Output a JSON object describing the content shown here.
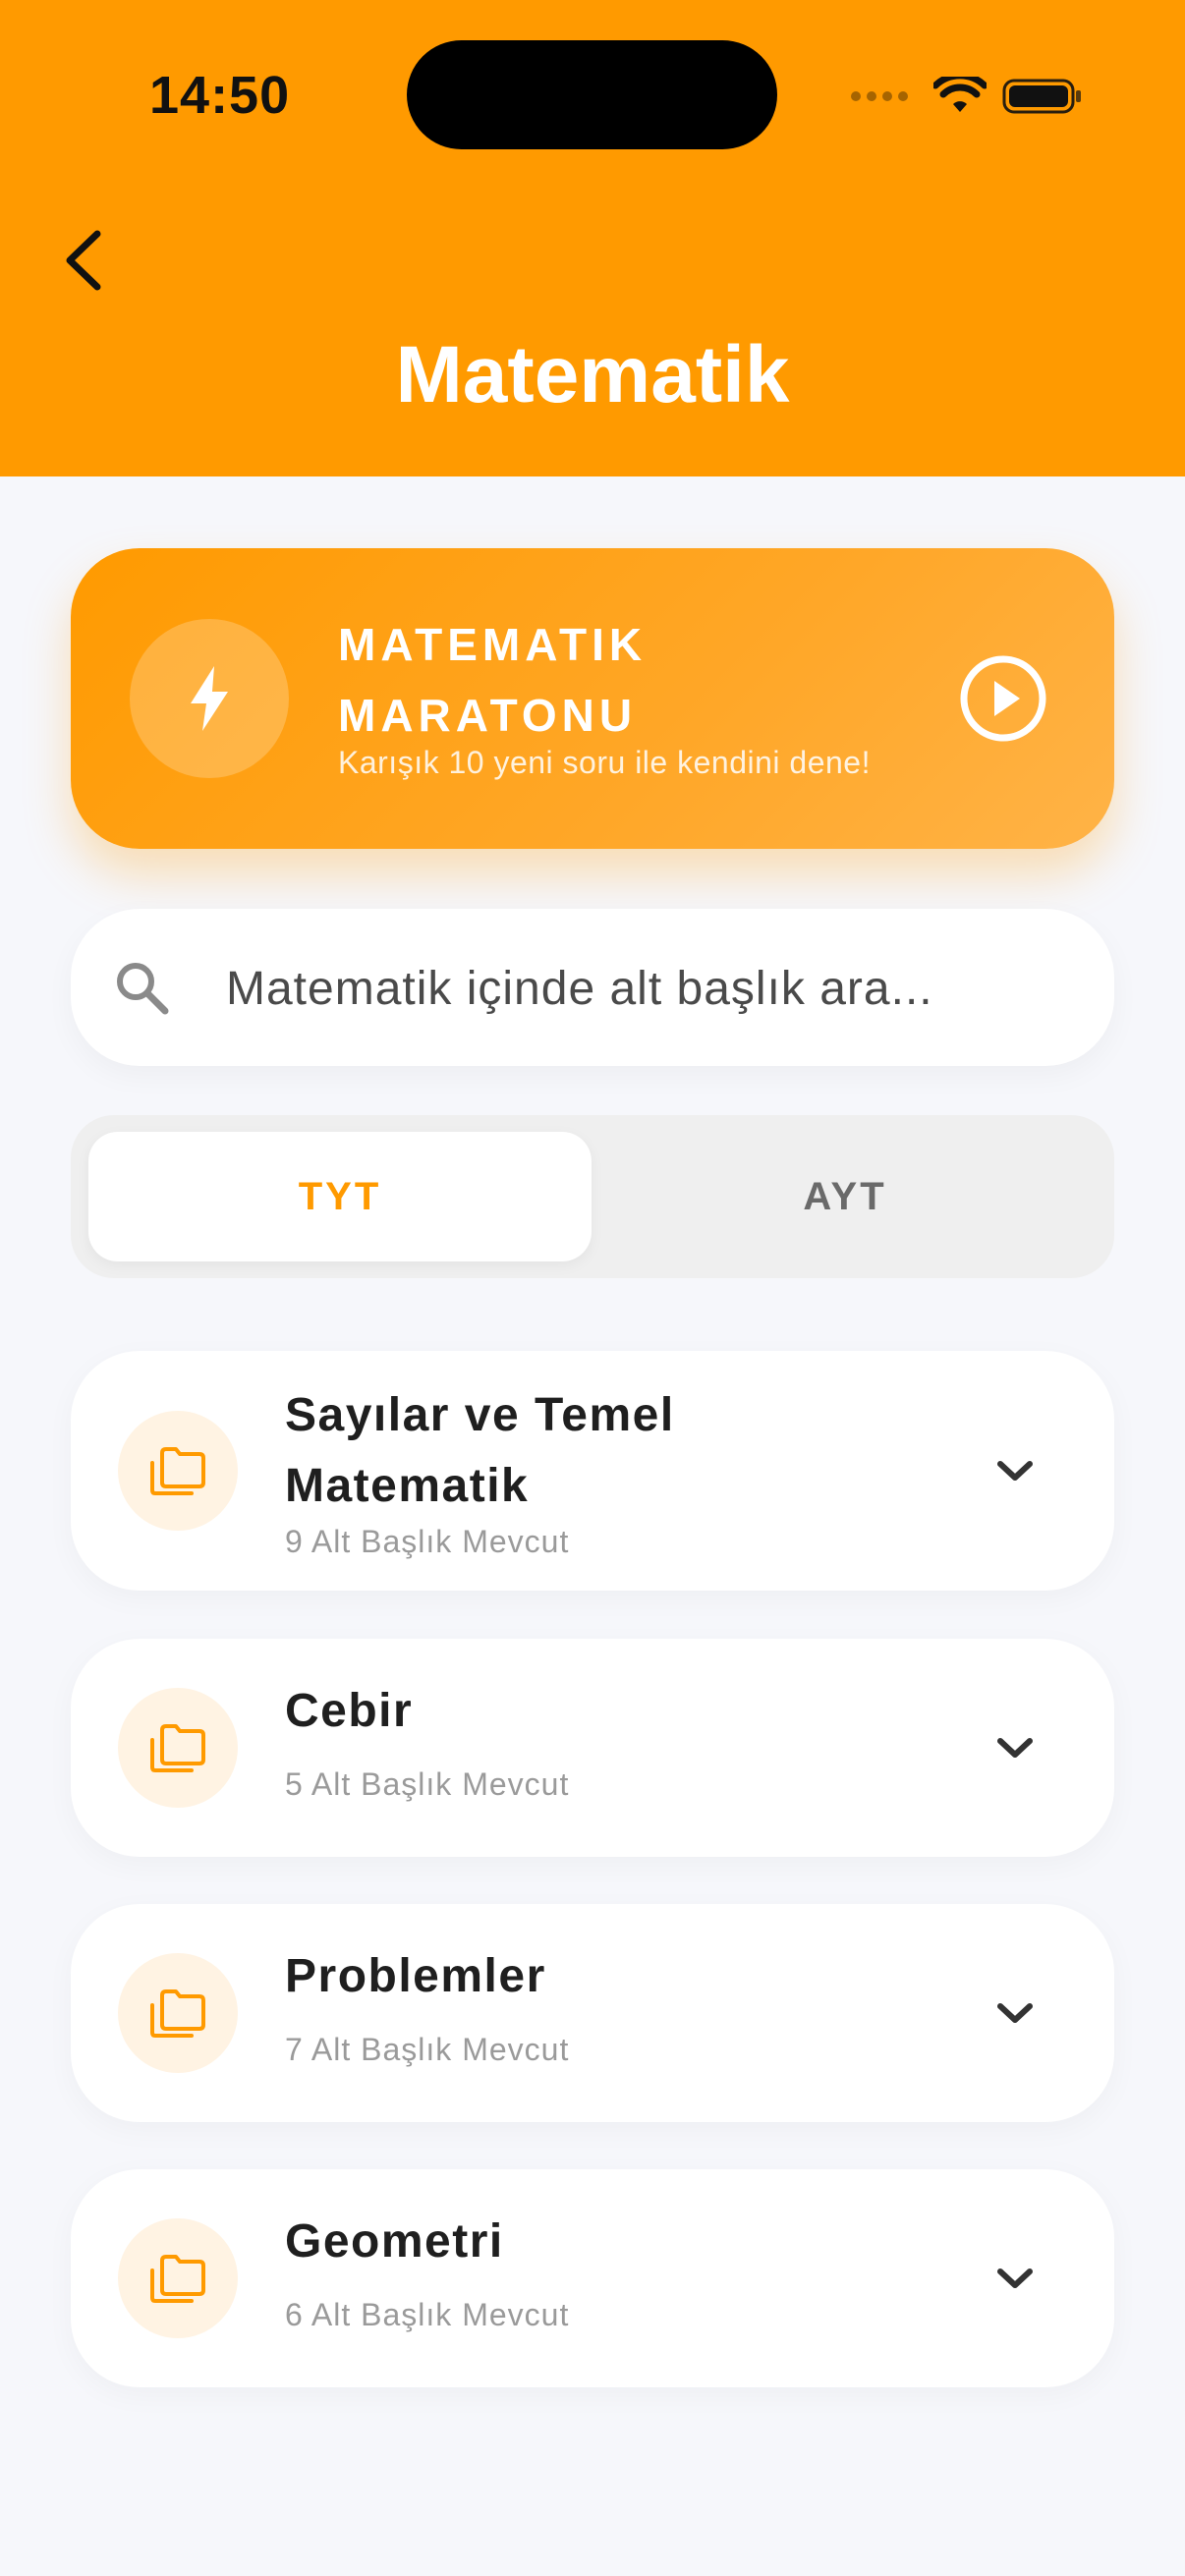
{
  "status_bar": {
    "time": "14:50"
  },
  "header": {
    "title": "Matematik",
    "background_color": "#FF9A00"
  },
  "marathon": {
    "title": "MATEMATIK MARATONU",
    "subtitle": "Karışık 10 yeni soru ile kendini dene!",
    "icon": "lightning-bolt-icon",
    "action_icon": "play-circle-icon"
  },
  "search": {
    "placeholder": "Matematik içinde alt başlık ara...",
    "value": "",
    "icon": "search-icon"
  },
  "tabs": {
    "items": [
      {
        "label": "TYT",
        "selected": true
      },
      {
        "label": "AYT",
        "selected": false
      }
    ],
    "active_color": "#FF9A00"
  },
  "topics": [
    {
      "title": "Sayılar ve Temel Matematik",
      "subtitle": "9 Alt Başlık Mevcut",
      "icon": "folder-icon"
    },
    {
      "title": "Cebir",
      "subtitle": "5 Alt Başlık Mevcut",
      "icon": "folder-icon"
    },
    {
      "title": "Problemler",
      "subtitle": "7 Alt Başlık Mevcut",
      "icon": "folder-icon"
    },
    {
      "title": "Geometri",
      "subtitle": "6 Alt Başlık Mevcut",
      "icon": "folder-icon"
    }
  ]
}
